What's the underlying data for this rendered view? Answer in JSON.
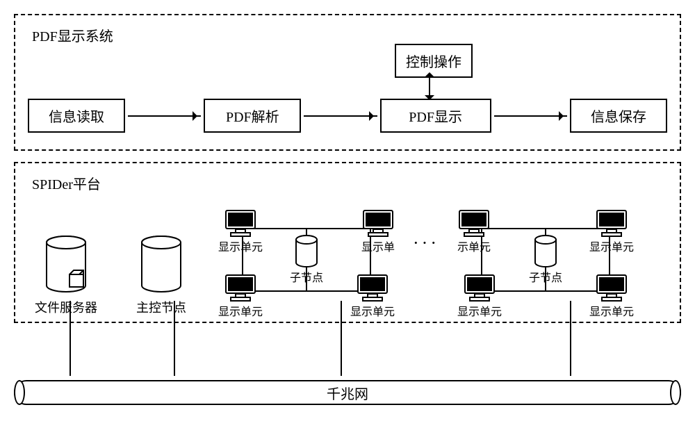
{
  "top": {
    "title": "PDF显示系统",
    "steps": [
      "信息读取",
      "PDF解析",
      "PDF显示",
      "信息保存"
    ],
    "control": "控制操作"
  },
  "platform": {
    "title": "SPIDer平台",
    "file_server": "文件服务器",
    "master_node": "主控节点",
    "sub_node": "子节点",
    "ellipsis": "···",
    "cluster1": {
      "top_left": "显示单元",
      "top_right": "显示单",
      "bottom_left": "显示单元",
      "bottom_right": "显示单元"
    },
    "cluster2": {
      "top_left": "示单元",
      "top_right": "显示单元",
      "bottom_left": "显示单元",
      "bottom_right": "显示单元"
    }
  },
  "network": "千兆网"
}
